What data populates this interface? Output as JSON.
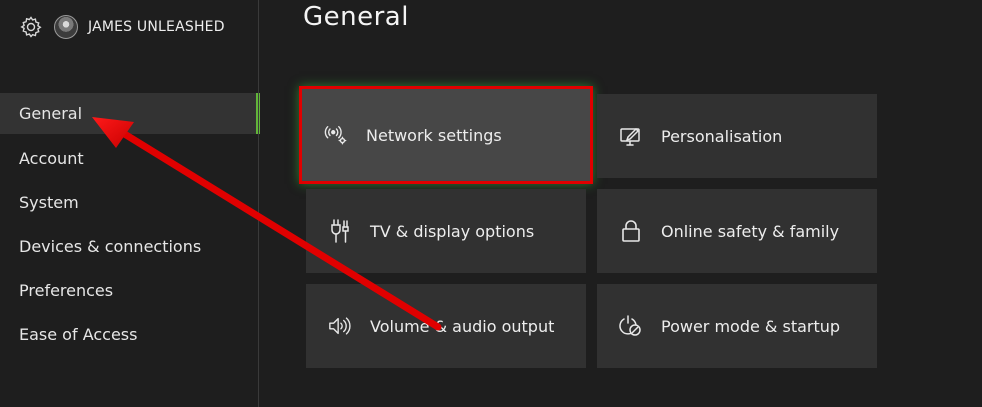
{
  "profile": {
    "gamertag": "JAMES UNLEASHED"
  },
  "sidebar": {
    "items": [
      {
        "label": "General"
      },
      {
        "label": "Account"
      },
      {
        "label": "System"
      },
      {
        "label": "Devices & connections"
      },
      {
        "label": "Preferences"
      },
      {
        "label": "Ease of Access"
      }
    ],
    "selected": "General"
  },
  "main": {
    "title": "General",
    "tiles": [
      {
        "label": "Network settings",
        "icon": "network-icon"
      },
      {
        "label": "Personalisation",
        "icon": "personalisation-icon"
      },
      {
        "label": "TV & display options",
        "icon": "tv-display-icon"
      },
      {
        "label": "Online safety & family",
        "icon": "lock-icon"
      },
      {
        "label": "Volume & audio output",
        "icon": "speaker-icon"
      },
      {
        "label": "Power mode & startup",
        "icon": "power-icon"
      }
    ],
    "focused": "Network settings"
  },
  "colors": {
    "background": "#1e1e1e",
    "tile": "#313131",
    "tile_focused": "#474747",
    "accent_green": "#62b53a",
    "annotation_red": "#e00000"
  }
}
